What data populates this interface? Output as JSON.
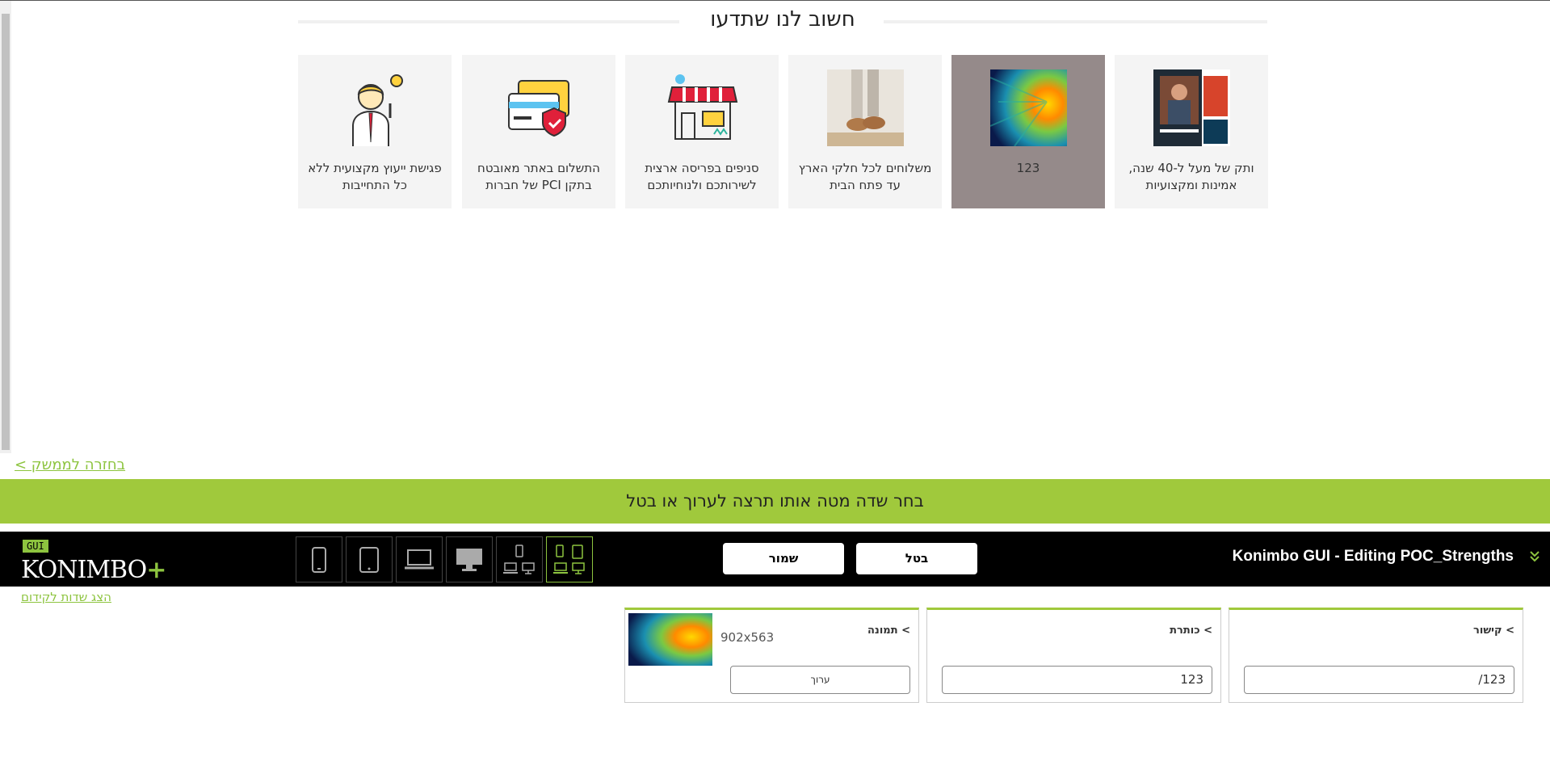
{
  "preview": {
    "section_title": "חשוב לנו שתדעו",
    "cards": [
      {
        "text": "ותק של מעל ל-40 שנה, אמינות ומקצועיות",
        "image": "photo-screenshot-icon"
      },
      {
        "text": "123",
        "image": "colorful-burst-image",
        "selected": true
      },
      {
        "text": "משלוחים לכל חלקי הארץ עד פתח הבית",
        "image": "feet-sandals-photo"
      },
      {
        "text": "סניפים בפריסה ארצית לשירותכם ולנוחיותכם",
        "image": "storefront-icon"
      },
      {
        "text": "התשלום באתר מאובטח בתקן PCI של חברות",
        "image": "secure-payment-icon"
      },
      {
        "text": "פגישת ייעוץ מקצועית ללא כל התחייבות",
        "image": "consultant-icon"
      }
    ],
    "back_link": "בחזרה לממשק >"
  },
  "instruction_bar": "בחר שדה מטה אותו תרצה לערוך או בטל",
  "toolbar": {
    "logo_badge": "GUI",
    "logo_text": "KONIMBO",
    "logo_plus": "+",
    "devices": [
      "mobile",
      "tablet",
      "laptop",
      "desktop",
      "multi-device-small",
      "multi-device-all"
    ],
    "active_device": "multi-device-all",
    "save_label": "שמור",
    "cancel_label": "בטל",
    "editing_title": "Konimbo GUI - Editing POC_Strengths",
    "accent_color": "#8dc43f"
  },
  "editor": {
    "show_fields_link": "הצג שדות לקידום",
    "fields": {
      "link": {
        "label": "> קישור",
        "value": "/123"
      },
      "title": {
        "label": "> כותרת",
        "value": "123"
      },
      "image": {
        "label": "> תמונה",
        "size": "902x563",
        "edit_label": "ערוך"
      }
    }
  }
}
